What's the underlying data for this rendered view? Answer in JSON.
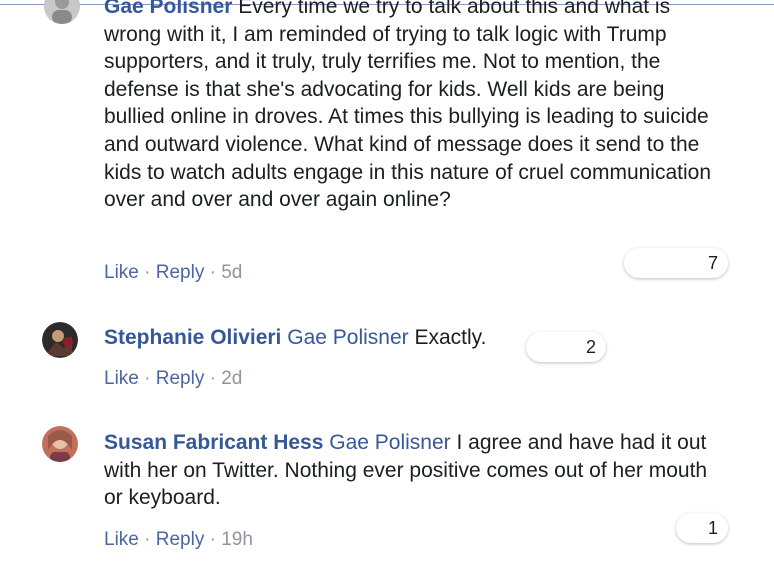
{
  "comments": [
    {
      "author": "Gae Polisner",
      "tag": "",
      "text": "Every time we try to talk about this and what is wrong with it, I am reminded of trying to talk logic with Trump supporters, and it truly, truly terrifies me. Not to mention, the defense is that she's advocating for kids. Well kids are being bullied online in droves. At times this bullying is leading to suicide and outward violence. What kind of message does it send to the kids to watch adults engage in this nature of cruel communication over and over and over again online?",
      "like": "Like",
      "reply": "Reply",
      "sep": "·",
      "time": "5d",
      "reactions": "7"
    },
    {
      "author": "Stephanie Olivieri",
      "tag": "Gae Polisner",
      "text": "Exactly.",
      "like": "Like",
      "reply": "Reply",
      "sep": "·",
      "time": "2d",
      "reactions": "2"
    },
    {
      "author": "Susan Fabricant Hess",
      "tag": "Gae Polisner",
      "text": "I agree and have had it out with her on Twitter. Nothing ever positive comes out of her mouth or keyboard.",
      "like": "Like",
      "reply": "Reply",
      "sep": "·",
      "time": "19h",
      "reactions": "1"
    }
  ]
}
